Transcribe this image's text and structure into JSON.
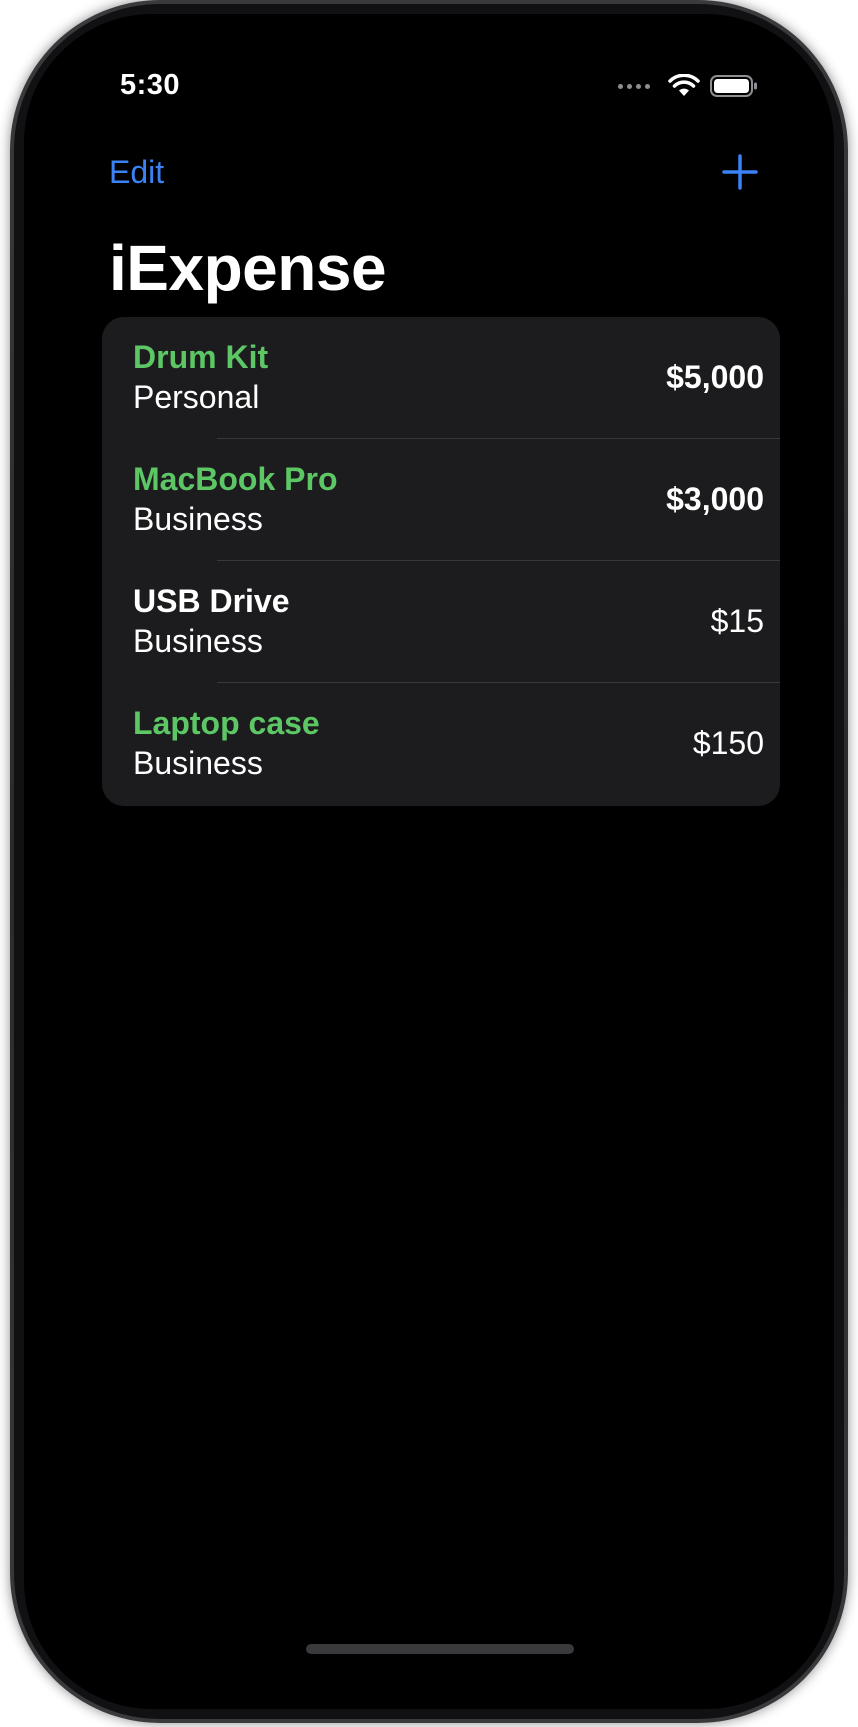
{
  "status_bar": {
    "time": "5:30",
    "signal_icon": "cellular-dots-icon",
    "wifi_icon": "wifi-icon",
    "battery_icon": "battery-icon"
  },
  "nav": {
    "edit_label": "Edit",
    "add_icon": "plus-icon",
    "title": "iExpense"
  },
  "colors": {
    "accent": "#3b82f6",
    "highlight": "#5cc764",
    "background": "#000000",
    "cell": "#1c1c1e"
  },
  "expenses": [
    {
      "name": "Drum Kit",
      "type": "Personal",
      "amount": "$5,000",
      "highlighted": true,
      "bold_amount": true
    },
    {
      "name": "MacBook Pro",
      "type": "Business",
      "amount": "$3,000",
      "highlighted": true,
      "bold_amount": true
    },
    {
      "name": "USB Drive",
      "type": "Business",
      "amount": "$15",
      "highlighted": false,
      "bold_amount": false
    },
    {
      "name": "Laptop case",
      "type": "Business",
      "amount": "$150",
      "highlighted": true,
      "bold_amount": false
    }
  ]
}
